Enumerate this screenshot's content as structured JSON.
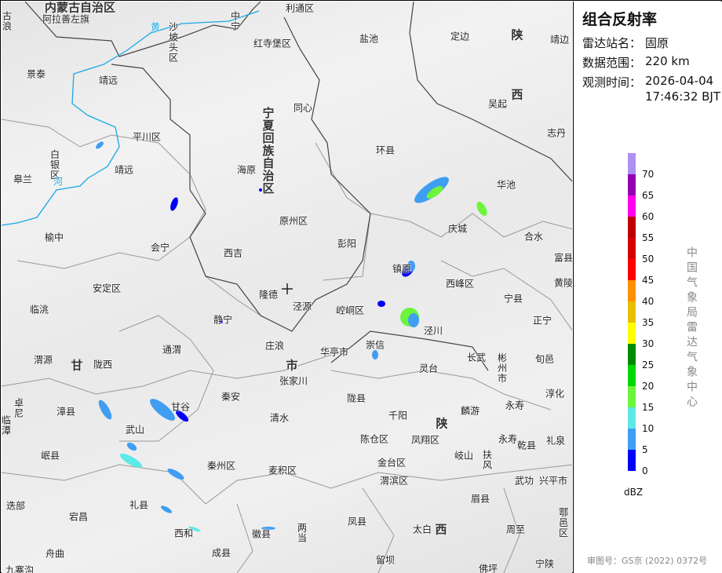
{
  "panel": {
    "title": "组合反射率",
    "station_label": "雷达站名：",
    "station": "固原",
    "range_label": "数据范围：",
    "range": "220 km",
    "time_label": "观测时间：",
    "date": "2026-04-04",
    "time": "17:46:32 BJT",
    "legend": {
      "unit": "dBZ",
      "ticks": [
        "70",
        "65",
        "60",
        "55",
        "50",
        "45",
        "40",
        "35",
        "30",
        "25",
        "20",
        "15",
        "10",
        "5",
        "0"
      ],
      "colors": [
        "#ad90f0",
        "#9600b4",
        "#ff00f0",
        "#c00000",
        "#d60000",
        "#ff0000",
        "#ff9000",
        "#e7c000",
        "#ffff00",
        "#008c00",
        "#00d800",
        "#6ef43c",
        "#5ee8e8",
        "#409ef2",
        "#0000f6"
      ]
    },
    "org": "中国气象局雷达气象中心",
    "copyright": "审图号：GS京 (2022) 0372号"
  },
  "map": {
    "radar_site_icon": "crosshair-icon",
    "labels": [
      "内蒙古自治区",
      "阿拉善左旗",
      "古浪",
      "沙坡头区",
      "中宁",
      "利通区",
      "红寺堡区",
      "盐池",
      "定边",
      "陕",
      "靖边",
      "景泰",
      "靖远",
      "宁夏回族自治区",
      "同心",
      "吴起",
      "西",
      "志丹",
      "平川区",
      "白银区",
      "靖远",
      "皋兰",
      "环县",
      "海原",
      "华池",
      "原州区",
      "榆中",
      "会宁",
      "西吉",
      "彭阳",
      "庆城",
      "合水",
      "镇原",
      "富县",
      "西峰区",
      "黄陵",
      "安定区",
      "隆德",
      "泾源",
      "崆峒区",
      "宁县",
      "临洮",
      "静宁",
      "正宁",
      "通渭",
      "庄浪",
      "华亭市",
      "崇信",
      "泾川",
      "长武",
      "彬州市",
      "旬邑",
      "渭源",
      "甘",
      "陇西",
      "秦安",
      "张家川",
      "灵台",
      "淳化",
      "卓尼",
      "漳县",
      "甘谷",
      "清水",
      "陇县",
      "麟游",
      "千阳",
      "陕",
      "临潭",
      "武山",
      "陈仓区",
      "凤翔区",
      "永寿",
      "乾县",
      "永寿",
      "礼泉",
      "岷县",
      "岐山",
      "扶风",
      "金台区",
      "秦州区",
      "麦积区",
      "武功",
      "兴平市",
      "渭滨区",
      "迭部",
      "礼县",
      "眉县",
      "宕昌",
      "凤县",
      "两当",
      "太白",
      "西",
      "周至",
      "鄠邑区",
      "西和",
      "徽县",
      "成县",
      "舟曲",
      "留坝",
      "佛坪",
      "宁陕",
      "九寨沟",
      "黄",
      "河",
      "市"
    ]
  }
}
